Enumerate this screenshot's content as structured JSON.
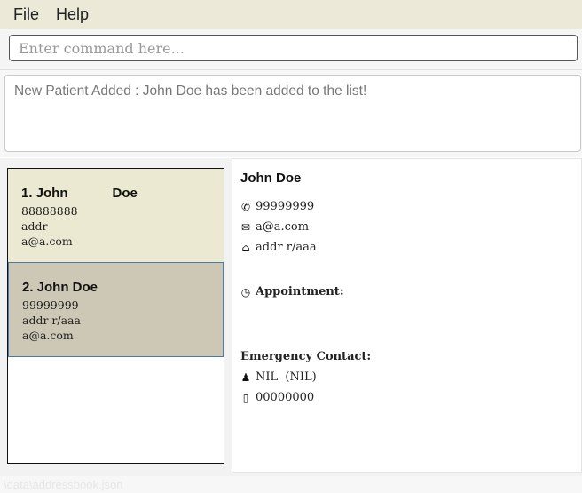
{
  "menu": {
    "file": "File",
    "help": "Help"
  },
  "command": {
    "placeholder": "Enter command here..."
  },
  "result": {
    "message": "New Patient Added : John Doe has been added to the list!"
  },
  "patients": [
    {
      "title": "1. John            Doe",
      "phone": "88888888",
      "address": "addr",
      "email": "a@a.com"
    },
    {
      "title": "2. John Doe",
      "phone": "99999999",
      "address": "addr r/aaa",
      "email": "a@a.com"
    }
  ],
  "detail": {
    "name": "John Doe",
    "phone": "99999999",
    "email": "a@a.com",
    "address": "addr r/aaa",
    "appointment_label": "Appointment:",
    "emergency_label": "Emergency Contact:",
    "emergency_name": "NIL  (NIL)",
    "emergency_phone": "00000000"
  },
  "footer": {
    "path": "\\data\\addressbook.json"
  },
  "icons": {
    "phone": "phone-icon",
    "email": "mail-icon",
    "address": "home-icon",
    "appointment": "clock-icon",
    "contact_person": "person-icon",
    "contact_phone": "mobile-icon"
  }
}
